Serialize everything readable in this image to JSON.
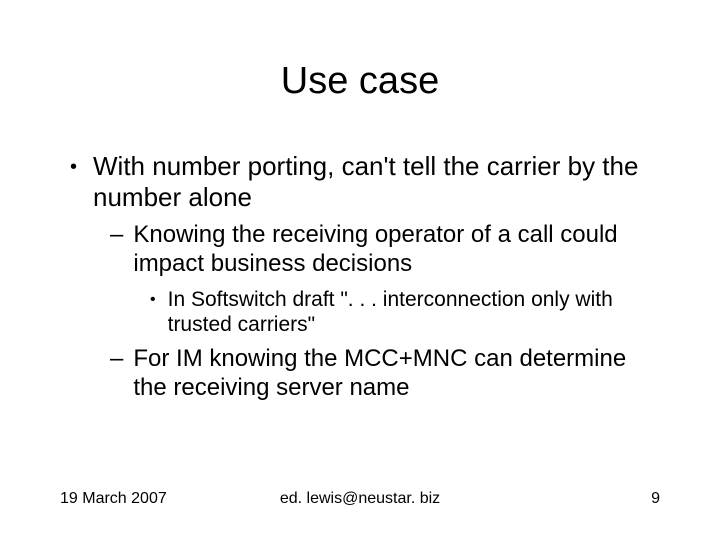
{
  "title": "Use case",
  "bullets": {
    "l1_1": "With number porting, can't tell the carrier by the number alone",
    "l2_1": "Knowing the receiving operator of a call could impact business decisions",
    "l3_1": "In Softswitch draft \". . . interconnection only with trusted carriers\"",
    "l2_2": "For IM knowing the MCC+MNC can determine the receiving server name"
  },
  "footer": {
    "date": "19 March 2007",
    "email": "ed. lewis@neustar. biz",
    "page": "9"
  }
}
